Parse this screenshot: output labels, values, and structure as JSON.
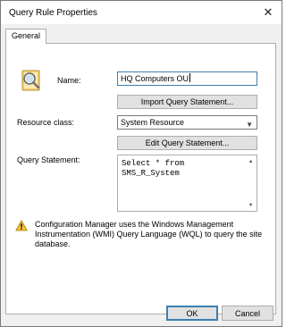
{
  "window": {
    "title": "Query Rule Properties"
  },
  "tabs": [
    {
      "label": "General"
    }
  ],
  "form": {
    "name_label": "Name:",
    "name_value": "HQ Computers OU",
    "import_button": "Import Query Statement...",
    "resource_class_label": "Resource class:",
    "resource_class_value": "System Resource",
    "edit_button": "Edit Query Statement...",
    "query_label": "Query Statement:",
    "query_text": "Select * from\nSMS_R_System"
  },
  "info": {
    "message": "Configuration Manager uses the Windows Management Instrumentation (WMI) Query Language (WQL) to query the site database."
  },
  "footer": {
    "ok_label": "OK",
    "cancel_label": "Cancel"
  },
  "icons": {
    "rule_icon": "query-rule-icon",
    "warning_icon": "warning-icon",
    "close_icon": "close-icon",
    "dropdown_icon": "chevron-down-icon"
  },
  "colors": {
    "focus_border": "#3c7fb1",
    "button_face": "#e1e1e1",
    "dialog_background": "#f0f0f0"
  }
}
